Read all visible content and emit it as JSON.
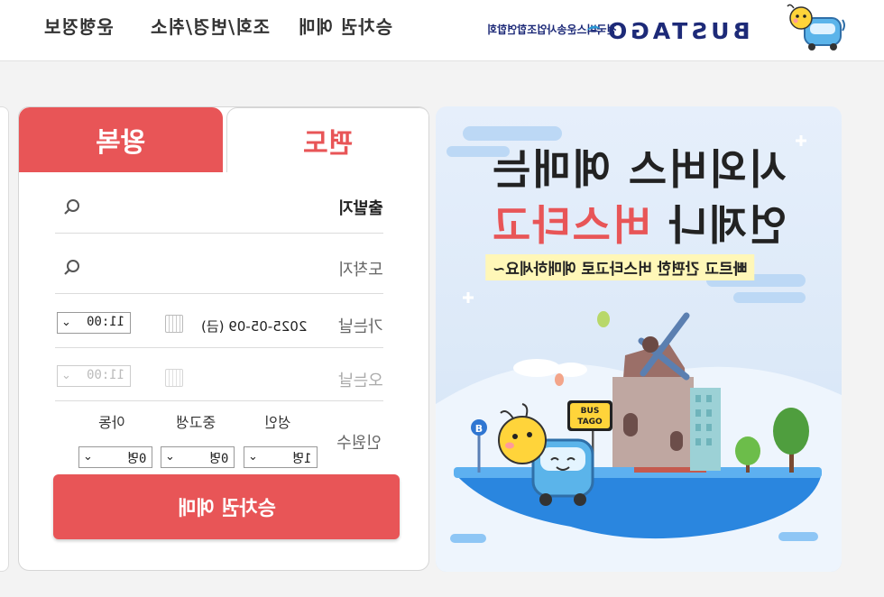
{
  "header": {
    "nav": [
      "운행정보",
      "조회/변경/취소",
      "승차권 예매"
    ],
    "logo_text": "BUSTAGO",
    "org_name": "전국버스운송사업조합연합회",
    "brand_color": "#1d2a78"
  },
  "form": {
    "tabs": {
      "round_trip": "왕복",
      "one_way": "편도",
      "active": "one_way"
    },
    "departure": {
      "label": "출발지",
      "value": "",
      "icon": "search-icon"
    },
    "arrival": {
      "label": "도착지",
      "value": "",
      "icon": "search-icon"
    },
    "go_date": {
      "label": "가는날",
      "date": "2025-05-09 (금)",
      "time": "11:00",
      "icon": "calendar-icon"
    },
    "return_date": {
      "label": "오는날",
      "date": "",
      "time": "11:00",
      "icon": "calendar-icon",
      "disabled": true
    },
    "passengers": {
      "label": "인원수",
      "adult": {
        "label": "성인",
        "value": "1명"
      },
      "teen": {
        "label": "중고생",
        "value": "0명"
      },
      "child": {
        "label": "아동",
        "value": "0명"
      }
    },
    "submit_label": "승차권 예매",
    "accent_color": "#e85557"
  },
  "banner": {
    "line1": "시외버스 예매는",
    "line2_black": "언제나 ",
    "line2_red": "버스타고",
    "subtitle": "빠르고 간편한 버스타고로 예매하세요~",
    "sign_text_1": "BUS",
    "sign_text_2": "TAGO",
    "stop_sign": "B"
  }
}
